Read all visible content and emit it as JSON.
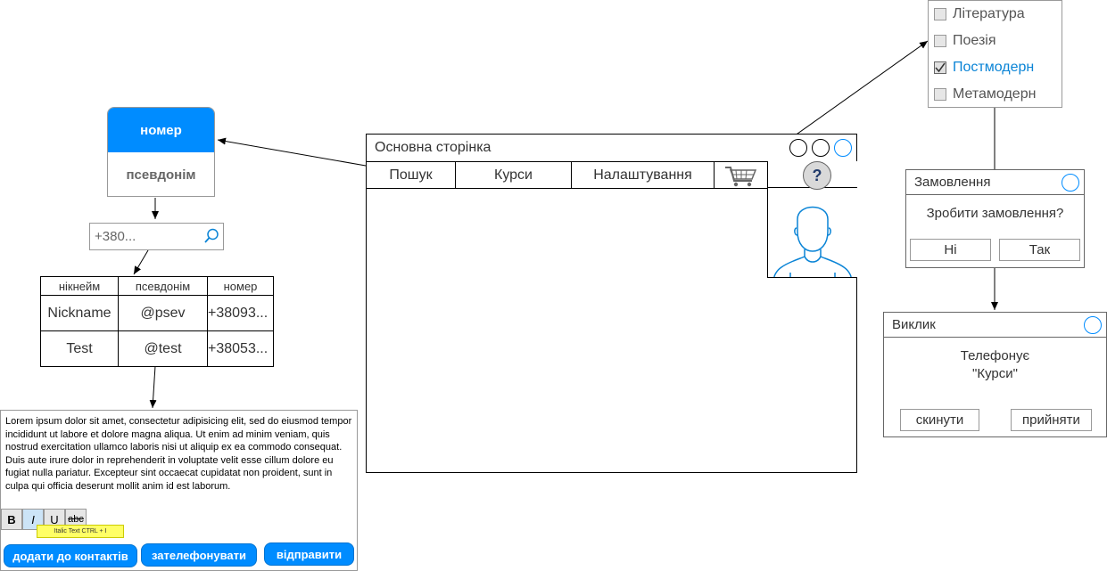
{
  "contact_card": {
    "header": "номер",
    "body": "псевдонім"
  },
  "phone_search": {
    "value": "+380..."
  },
  "contacts_table": {
    "columns": [
      "нікнейм",
      "псевдонім",
      "номер"
    ],
    "rows": [
      [
        "Nickname",
        "@psev",
        "+38093..."
      ],
      [
        "Test",
        "@test",
        "+38053..."
      ]
    ]
  },
  "editor": {
    "text": "Lorem ipsum dolor sit amet, consectetur adipisicing elit, sed do eiusmod tempor incididunt ut labore et dolore magna aliqua. Ut enim ad minim veniam, quis nostrud exercitation ullamco laboris nisi ut aliquip ex ea commodo consequat. Duis aute irure dolor in reprehenderit in voluptate velit esse cillum dolore eu fugiat nulla pariatur. Excepteur sint occaecat cupidatat non proident, sunt in culpa qui officia deserunt mollit anim id est laborum.",
    "format_buttons": {
      "bold": "B",
      "italic": "I",
      "underline": "U",
      "strike": "abc"
    },
    "tooltip": "Italic Text CTRL + I",
    "actions": {
      "add_contact": "додати до контактів",
      "call": "зателефонувати",
      "send": "відправити"
    }
  },
  "main_window": {
    "title": "Основна сторінка",
    "tabs": {
      "search": "Пошук",
      "courses": "Курси",
      "settings": "Налаштування"
    },
    "help_symbol": "?"
  },
  "genre_checklist": {
    "items": [
      {
        "label": "Література",
        "checked": false
      },
      {
        "label": "Поезія",
        "checked": false
      },
      {
        "label": "Постмодерн",
        "checked": true
      },
      {
        "label": "Метамодерн",
        "checked": false
      }
    ]
  },
  "order_dialog": {
    "title": "Замовлення",
    "question": "Зробити замовлення?",
    "no": "Ні",
    "yes": "Так"
  },
  "call_dialog": {
    "title": "Виклик",
    "line1": "Телефонує",
    "line2": "\"Курси\"",
    "decline": "скинути",
    "accept": "прийняти"
  },
  "colors": {
    "accent": "#008cff",
    "checked_text": "#0a84d6",
    "tooltip": "#ffff66"
  }
}
